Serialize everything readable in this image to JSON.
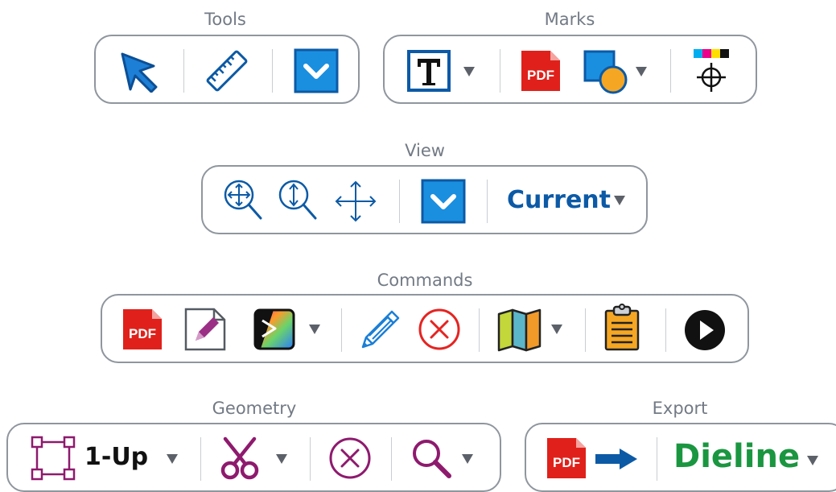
{
  "groups": {
    "tools": {
      "title": "Tools"
    },
    "marks": {
      "title": "Marks"
    },
    "view": {
      "title": "View",
      "view_mode_label": "Current"
    },
    "commands": {
      "title": "Commands"
    },
    "geometry": {
      "title": "Geometry",
      "layout_label": "1-Up"
    },
    "export": {
      "title": "Export",
      "format_label": "Dieline"
    }
  },
  "colors": {
    "border": "#8f969e",
    "title": "#727a85",
    "blue": "#0c5aa6",
    "pdf_red": "#e0211b",
    "green": "#1a9640",
    "magenta": "#8e1a6e",
    "red_outline": "#e52421",
    "dropdown_arrow": "#5c6169"
  },
  "icons": [
    "select-arrow-icon",
    "ruler-icon",
    "expand-panel-icon",
    "text-mark-icon",
    "pdf-mark-icon",
    "shape-mark-icon",
    "registration-mark-icon",
    "zoom-fit-icon",
    "zoom-height-icon",
    "pan-icon",
    "pdf-icon",
    "edit-document-icon",
    "preview-gradient-icon",
    "pencil-icon",
    "cancel-circle-icon",
    "map-icon",
    "clipboard-icon",
    "play-icon",
    "layout-frame-icon",
    "scissors-icon",
    "delete-circle-icon",
    "magnifier-icon",
    "pdf-export-icon",
    "arrow-right-icon"
  ]
}
